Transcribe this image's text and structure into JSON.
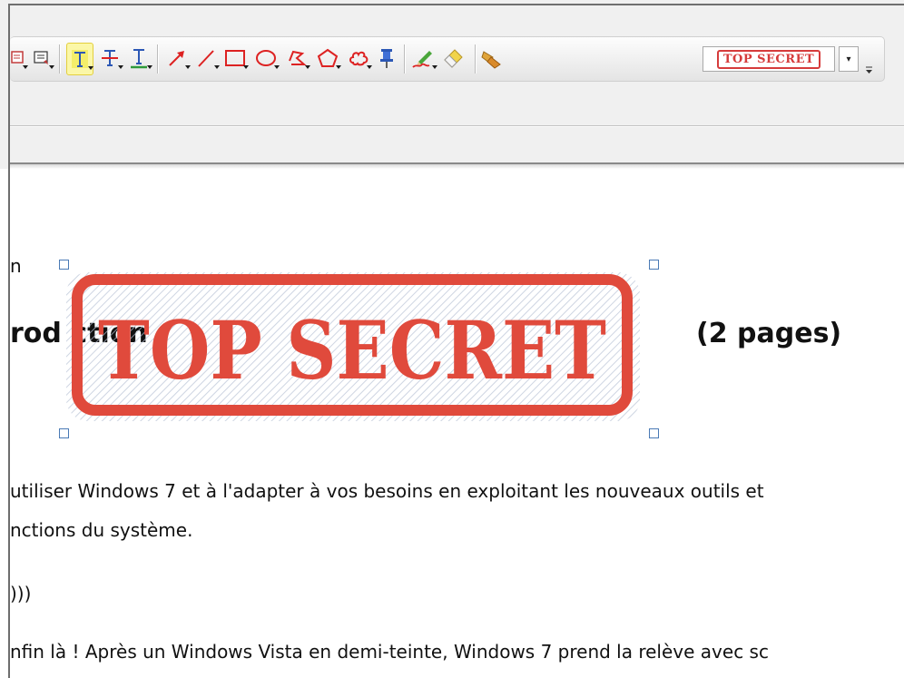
{
  "toolbar": {
    "tools": [
      {
        "name": "note-tool",
        "icon": "note-icon"
      },
      {
        "name": "text-box-tool",
        "icon": "text-box-icon"
      },
      {
        "name": "highlight-text-tool",
        "icon": "highlight-text-icon",
        "active": true
      },
      {
        "name": "strikeout-text-tool",
        "icon": "strikeout-text-icon"
      },
      {
        "name": "underline-text-tool",
        "icon": "underline-text-icon"
      },
      {
        "name": "arrow-tool",
        "icon": "arrow-icon"
      },
      {
        "name": "line-tool",
        "icon": "line-icon"
      },
      {
        "name": "rectangle-tool",
        "icon": "rectangle-icon"
      },
      {
        "name": "ellipse-tool",
        "icon": "ellipse-icon"
      },
      {
        "name": "polyline-tool",
        "icon": "polyline-icon"
      },
      {
        "name": "polygon-tool",
        "icon": "polygon-icon"
      },
      {
        "name": "cloud-tool",
        "icon": "cloud-icon"
      },
      {
        "name": "pin-tool",
        "icon": "pushpin-icon"
      },
      {
        "name": "pencil-tool",
        "icon": "pencil-icon"
      },
      {
        "name": "eraser-tool",
        "icon": "eraser-icon"
      },
      {
        "name": "stamp-tool",
        "icon": "stamp-icon"
      }
    ],
    "stamp_preset_label": "TOP SECRET",
    "stamp_dropdown_icon": "chevron-down-icon",
    "accent_color": "#d63b3b",
    "active_highlight_color": "#fbf7a8"
  },
  "document": {
    "line_n": "n",
    "heading_left": "rod   ction",
    "heading_right": "(2 pages)",
    "para1": "utiliser Windows 7 et à l'adapter à vos besoins en exploitant les nouveaux outils et",
    "para2": "nctions du système.",
    "para3": ")))",
    "para4": "nfin là ! Après un Windows Vista en demi-teinte, Windows 7 prend la relève avec sc"
  },
  "stamp_annotation": {
    "text": "TOP SECRET",
    "color": "#e04a3c",
    "selected": true
  }
}
